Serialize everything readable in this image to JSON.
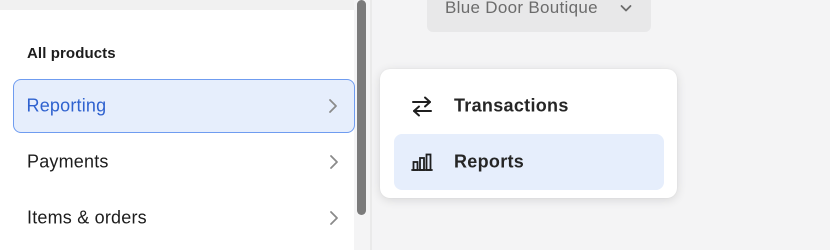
{
  "location_selector": {
    "label": "Blue Door Boutique",
    "icon": "chevron-down-icon"
  },
  "sidebar": {
    "heading": "All products",
    "items": [
      {
        "label": "Reporting",
        "selected": true,
        "icon": "chevron-right-icon"
      },
      {
        "label": "Payments",
        "selected": false,
        "icon": "chevron-right-icon"
      },
      {
        "label": "Items & orders",
        "selected": false,
        "icon": "chevron-right-icon"
      }
    ]
  },
  "reporting_menu": {
    "items": [
      {
        "label": "Transactions",
        "icon": "arrows-left-right-icon",
        "highlighted": false
      },
      {
        "label": "Reports",
        "icon": "bar-chart-icon",
        "highlighted": true
      }
    ]
  },
  "colors": {
    "accent": "#2f62cf",
    "selected_background": "#e6eefc",
    "selected_border": "#6f9cf0"
  }
}
